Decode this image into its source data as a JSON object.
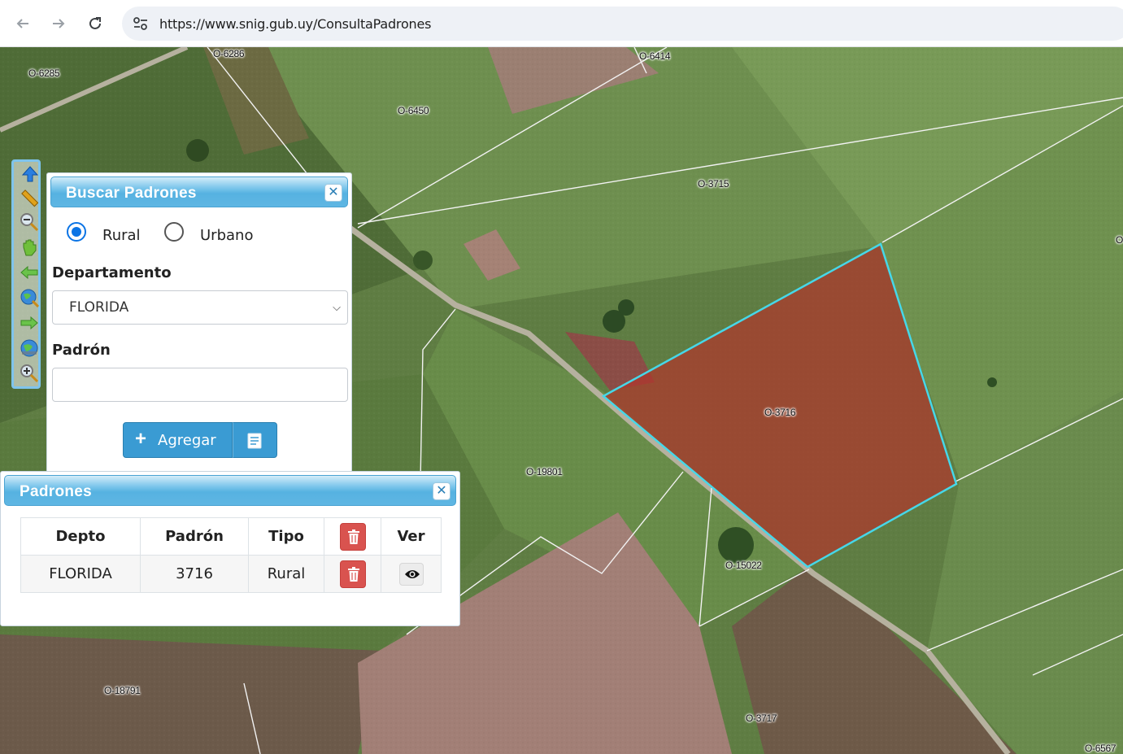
{
  "browser": {
    "url": "https://www.snig.gub.uy/ConsultaPadrones",
    "back_icon": "arrow-left-icon",
    "forward_icon": "arrow-right-icon",
    "reload_icon": "reload-icon"
  },
  "map": {
    "parcel_labels": [
      "O-6285",
      "O-6286",
      "O-6414",
      "O-6450",
      "O-3715",
      "O-3716",
      "O-19801",
      "O-15022",
      "O-18791",
      "O-3717",
      "O-6567",
      "O"
    ],
    "selected_parcel": "O-3716",
    "selected_fill": "#b0362c",
    "selected_outline": "#46d7e8"
  },
  "tools": [
    "pan-arrow-icon",
    "measure-ruler-icon",
    "zoom-out-icon",
    "hand-pan-icon",
    "previous-extent-icon",
    "zoom-full-globe-icon",
    "next-extent-icon",
    "world-icon",
    "zoom-in-icon"
  ],
  "search_panel": {
    "title": "Buscar Padrones",
    "radio_rural": "Rural",
    "radio_urbano": "Urbano",
    "selected_type": "Rural",
    "departamento_label": "Departamento",
    "departamento_value": "FLORIDA",
    "padron_label": "Padrón",
    "padron_value": "",
    "add_button": "Agregar"
  },
  "results_panel": {
    "title": "Padrones",
    "columns": [
      "Depto",
      "Padrón",
      "Tipo",
      "",
      "Ver"
    ],
    "rows": [
      {
        "depto": "FLORIDA",
        "padron": "3716",
        "tipo": "Rural"
      }
    ]
  },
  "colors": {
    "panel_header": "#56b2e1",
    "button_primary": "#3a9bd3",
    "danger": "#d9534f"
  }
}
